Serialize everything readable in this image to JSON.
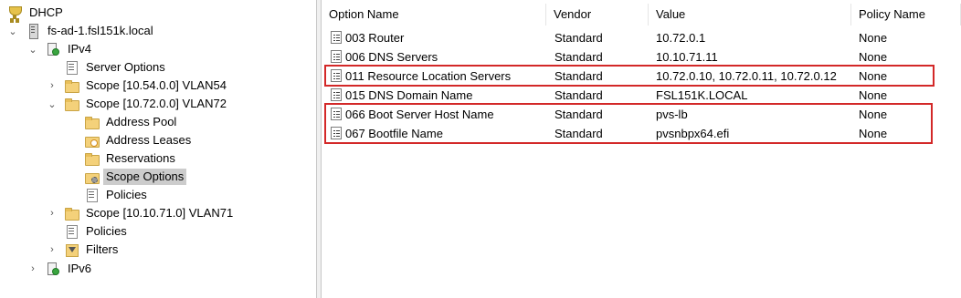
{
  "tree": {
    "dhcp": "DHCP",
    "server": "fs-ad-1.fsl151k.local",
    "ipv4": "IPv4",
    "server_options": "Server Options",
    "scope_54": "Scope [10.54.0.0] VLAN54",
    "scope_72": "Scope [10.72.0.0] VLAN72",
    "address_pool": "Address Pool",
    "address_leases": "Address Leases",
    "reservations": "Reservations",
    "scope_options": "Scope Options",
    "policies_scope": "Policies",
    "scope_71": "Scope [10.10.71.0] VLAN71",
    "policies": "Policies",
    "filters": "Filters",
    "ipv6": "IPv6"
  },
  "columns": {
    "option_name": "Option Name",
    "vendor": "Vendor",
    "value": "Value",
    "policy_name": "Policy Name"
  },
  "rows": [
    {
      "name": "003 Router",
      "vendor": "Standard",
      "value": "10.72.0.1",
      "policy": "None"
    },
    {
      "name": "006 DNS Servers",
      "vendor": "Standard",
      "value": "10.10.71.11",
      "policy": "None"
    },
    {
      "name": "011 Resource Location Servers",
      "vendor": "Standard",
      "value": "10.72.0.10, 10.72.0.11, 10.72.0.12",
      "policy": "None"
    },
    {
      "name": "015 DNS Domain Name",
      "vendor": "Standard",
      "value": "FSL151K.LOCAL",
      "policy": "None"
    },
    {
      "name": "066 Boot Server Host Name",
      "vendor": "Standard",
      "value": "pvs-lb",
      "policy": "None"
    },
    {
      "name": "067 Bootfile Name",
      "vendor": "Standard",
      "value": "pvsnbpx64.efi",
      "policy": "None"
    }
  ],
  "colors": {
    "highlight_border": "#d32828",
    "selection": "#cccccc"
  }
}
